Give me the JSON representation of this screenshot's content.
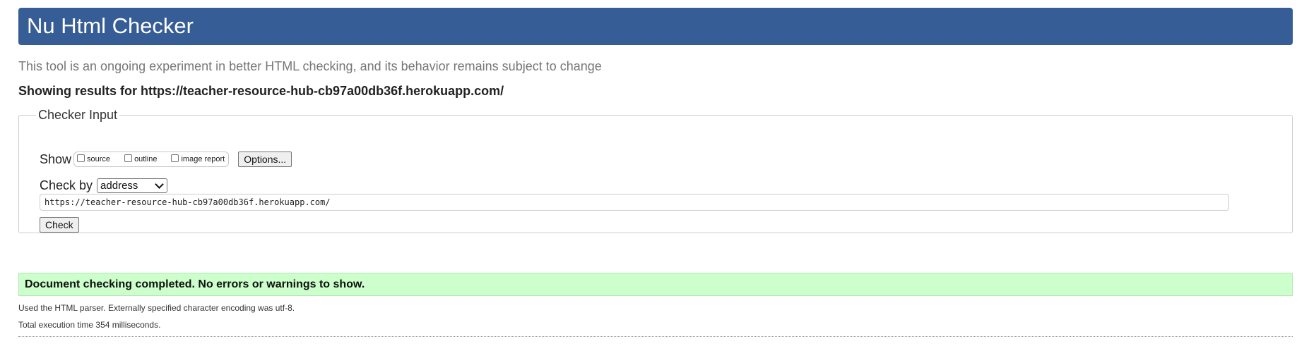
{
  "header": {
    "title": "Nu Html Checker",
    "banner_color": "#365d95"
  },
  "tagline": "This tool is an ongoing experiment in better HTML checking, and its behavior remains subject to change",
  "showing_results": "Showing results for https://teacher-resource-hub-cb97a00db36f.herokuapp.com/",
  "checker_input": {
    "legend": "Checker Input",
    "show_label": "Show",
    "show_options": [
      {
        "label": "source",
        "checked": false
      },
      {
        "label": "outline",
        "checked": false
      },
      {
        "label": "image report",
        "checked": false
      }
    ],
    "options_button": "Options...",
    "check_by_label": "Check by",
    "check_by_selected": "address",
    "url_value": "https://teacher-resource-hub-cb97a00db36f.herokuapp.com/",
    "check_button": "Check"
  },
  "result": {
    "message": "Document checking completed. No errors or warnings to show.",
    "color": "#ccffcc"
  },
  "details": {
    "parser": "Used the HTML parser. Externally specified character encoding was utf-8.",
    "execution_time": "Total execution time 354 milliseconds."
  }
}
